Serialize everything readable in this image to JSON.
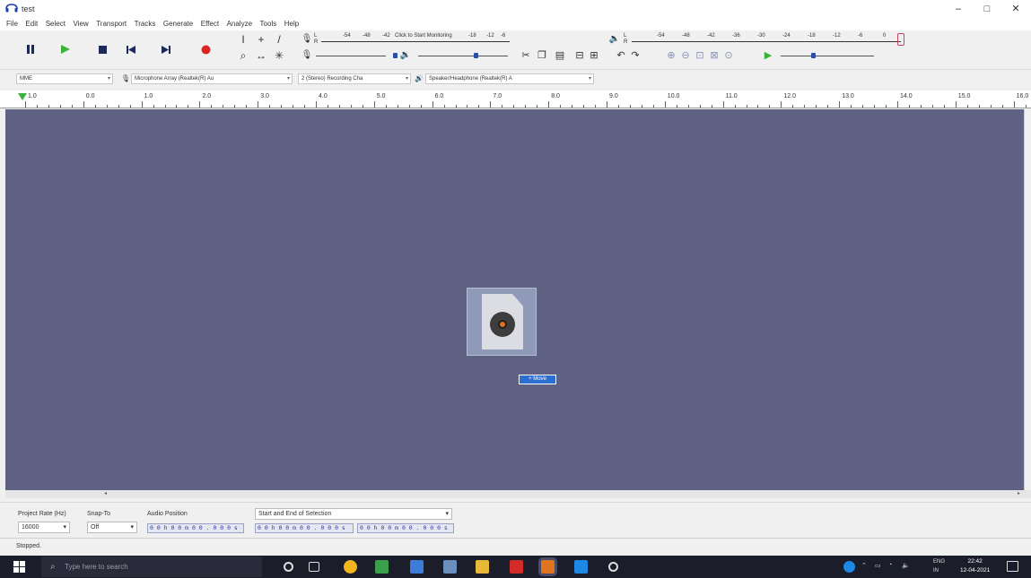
{
  "window": {
    "title": "test",
    "controls": {
      "minimize": "–",
      "maximize": "□",
      "close": "✕"
    }
  },
  "menu": [
    "File",
    "Edit",
    "Select",
    "View",
    "Transport",
    "Tracks",
    "Generate",
    "Effect",
    "Analyze",
    "Tools",
    "Help"
  ],
  "toolbar": {
    "meter_scale": [
      "-54",
      "-48",
      "-42",
      "-18",
      "-12",
      "-6",
      "0"
    ],
    "monitor_text": "Click to Start Monitoring",
    "playback_scale": [
      "-54",
      "-48",
      "-42",
      "-36",
      "-30",
      "-24",
      "-18",
      "-12",
      "-6",
      "0"
    ],
    "rec_meter_labels": [
      "L",
      "R"
    ],
    "play_meter_labels": [
      "L",
      "R"
    ]
  },
  "devices": {
    "host": "MME",
    "mic": "Microphone Array (Realtek(R) Au",
    "channels": "2 (Stereo) Recording Cha",
    "speaker": "Speaker/Headphone (Realtek(R) A"
  },
  "ruler": {
    "labels": [
      "1.0",
      "0.0",
      "1.0",
      "2.0",
      "3.0",
      "4.0",
      "5.0",
      "6.0",
      "7.0",
      "8.0",
      "9.0",
      "10.0",
      "11.0",
      "12.0",
      "13.0",
      "14.0",
      "15.0",
      "16.0"
    ]
  },
  "drag": {
    "badge": "+ Move"
  },
  "selection": {
    "project_rate_label": "Project Rate (Hz)",
    "project_rate": "16000",
    "snap_label": "Snap-To",
    "snap": "Off",
    "audio_position_label": "Audio Position",
    "audio_position": "0 0 h 0 0 m 0 0 . 0 0 0 s",
    "selection_label": "Start and End of Selection",
    "sel_start": "0 0 h 0 0 m 0 0 . 0 0 0 s",
    "sel_end": "0 0 h 0 0 m 0 0 . 0 0 0 s"
  },
  "status": {
    "text": "Stopped."
  },
  "taskbar": {
    "search_placeholder": "Type here to search",
    "lang_line1": "ENG",
    "lang_line2": "IN",
    "time": "22:42",
    "date": "12-04-2021"
  },
  "colors": {
    "track_bg": "#5f6283",
    "play_green": "#3bb33b",
    "record_red": "#e02424",
    "pause": "#1a2a5a",
    "taskbar": "#1c1d2b"
  }
}
